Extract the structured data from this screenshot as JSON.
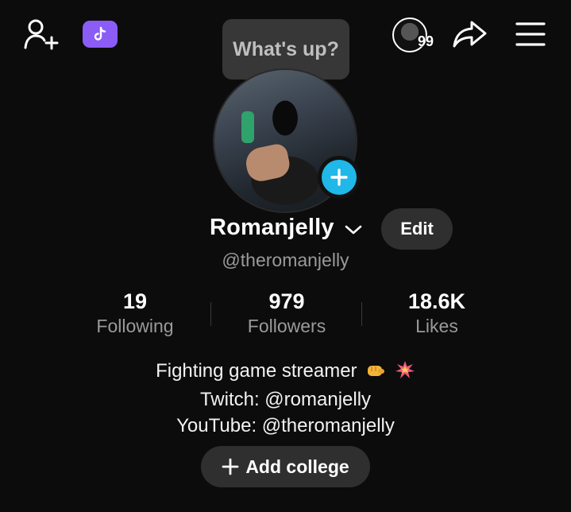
{
  "topbar": {
    "follower_mini_count": "99"
  },
  "bubble": {
    "text": "What's up?"
  },
  "profile": {
    "name": "Romanjelly",
    "handle": "@theromanjelly",
    "edit_label": "Edit"
  },
  "stats": {
    "following": {
      "count": "19",
      "label": "Following"
    },
    "followers": {
      "count": "979",
      "label": "Followers"
    },
    "likes": {
      "count": "18.6K",
      "label": "Likes"
    }
  },
  "bio": {
    "line1": "Fighting game streamer",
    "line2": "Twitch: @romanjelly",
    "line3": "YouTube: @theromanjelly"
  },
  "actions": {
    "add_college_label": "Add college"
  },
  "colors": {
    "background": "#0c0c0c",
    "accent_purple": "#8b5cf6",
    "add_story_blue": "#1fb8e8",
    "muted_text": "#9a9a9a",
    "button_bg": "#2f2f2f"
  },
  "icons": [
    "add-friend-icon",
    "tiktok-icon",
    "share-icon",
    "menu-icon",
    "plus-icon",
    "chevron-down-icon",
    "fist-emoji-icon",
    "collision-emoji-icon"
  ]
}
